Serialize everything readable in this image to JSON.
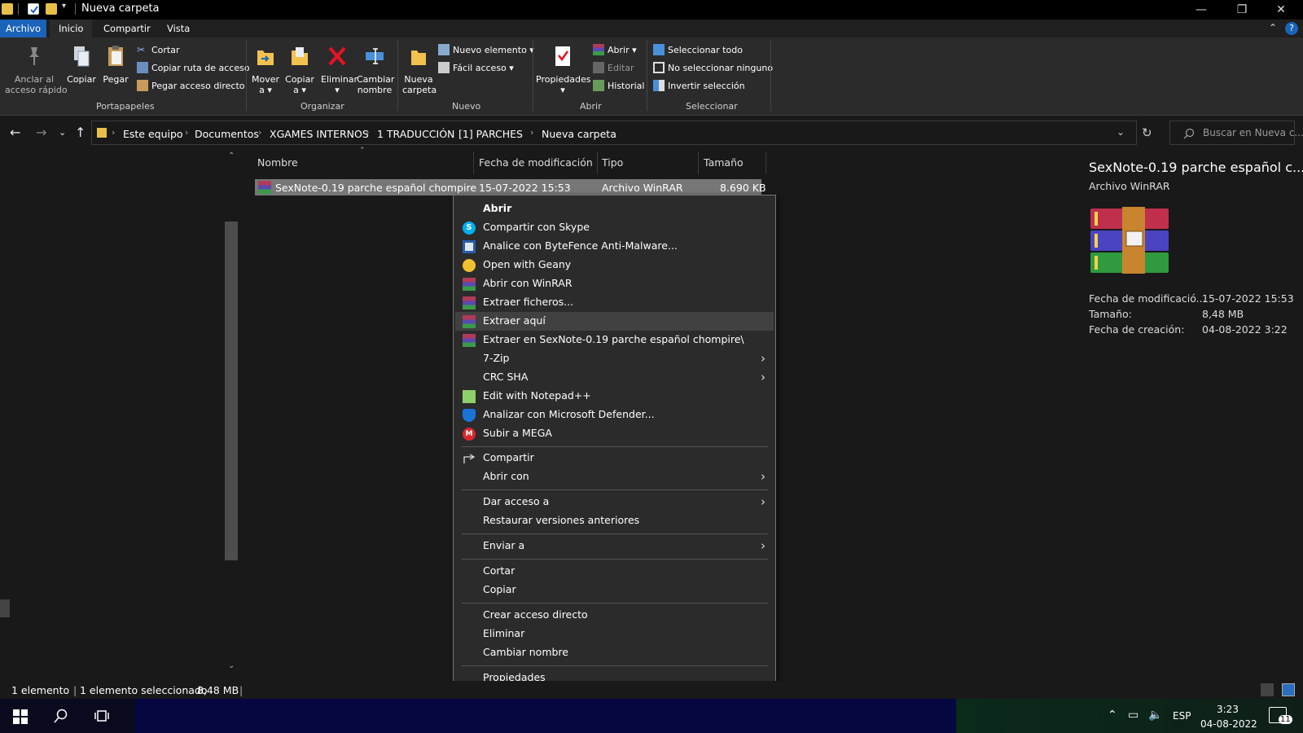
{
  "window": {
    "title": "Nueva carpeta",
    "controls": {
      "minimize": "—",
      "maximize": "❐",
      "close": "✕"
    }
  },
  "ribbon_tabs": [
    "Archivo",
    "Inicio",
    "Compartir",
    "Vista"
  ],
  "ribbon": {
    "portapapeles": {
      "anclar": "Anclar al\nacceso rápido",
      "copiar": "Copiar",
      "pegar": "Pegar",
      "cortar": "Cortar",
      "copiar_ruta": "Copiar ruta de acceso",
      "pegar_acceso": "Pegar acceso directo",
      "group": "Portapapeles"
    },
    "organizar": {
      "mover": "Mover\na ▾",
      "copiar": "Copiar\na ▾",
      "eliminar": "Eliminar\n▾",
      "cambiar": "Cambiar\nnombre",
      "group": "Organizar"
    },
    "nuevo": {
      "nueva_carpeta": "Nueva\ncarpeta",
      "nuevo_elemento": "Nuevo elemento ▾",
      "facil_acceso": "Fácil acceso ▾",
      "group": "Nuevo"
    },
    "abrir": {
      "propiedades": "Propiedades\n▾",
      "abrir": "Abrir ▾",
      "editar": "Editar",
      "historial": "Historial",
      "group": "Abrir"
    },
    "seleccionar": {
      "todo": "Seleccionar todo",
      "ninguno": "No seleccionar ninguno",
      "invertir": "Invertir selección",
      "group": "Seleccionar"
    }
  },
  "address": {
    "crumbs": [
      "Este equipo",
      "Documentos",
      "XGAMES INTERNOS",
      "1 TRADUCCIÓN",
      "[1] PARCHES",
      "Nueva carpeta"
    ],
    "search_placeholder": "Buscar en Nueva c..."
  },
  "columns": [
    "Nombre",
    "Fecha de modificación",
    "Tipo",
    "Tamaño"
  ],
  "file": {
    "name": "SexNote-0.19 parche español chompire",
    "date": "15-07-2022 15:53",
    "type": "Archivo WinRAR",
    "size": "8.690 KB"
  },
  "context_menu": [
    {
      "label": "Abrir",
      "icon": "none",
      "bold": true
    },
    {
      "label": "Compartir con Skype",
      "icon": "skype-icon"
    },
    {
      "label": "Analice con ByteFence Anti-Malware...",
      "icon": "bytefence-icon"
    },
    {
      "label": "Open with Geany",
      "icon": "geany-icon"
    },
    {
      "label": "Abrir con WinRAR",
      "icon": "winrar-icon"
    },
    {
      "label": "Extraer ficheros...",
      "icon": "winrar-icon"
    },
    {
      "label": "Extraer aquí",
      "icon": "winrar-icon",
      "highlight": true
    },
    {
      "label": "Extraer en SexNote-0.19 parche español chompire\\",
      "icon": "winrar-icon"
    },
    {
      "label": "7-Zip",
      "submenu": true
    },
    {
      "label": "CRC SHA",
      "submenu": true
    },
    {
      "label": "Edit with Notepad++",
      "icon": "notepadpp-icon"
    },
    {
      "label": "Analizar con Microsoft Defender...",
      "icon": "defender-icon"
    },
    {
      "label": "Subir a MEGA",
      "icon": "mega-icon"
    },
    {
      "label": "Compartir",
      "icon": "share-icon"
    },
    {
      "label": "Abrir con",
      "submenu": true
    },
    {
      "label": "Dar acceso a",
      "submenu": true
    },
    {
      "label": "Restaurar versiones anteriores"
    },
    {
      "label": "Enviar a",
      "submenu": true
    },
    {
      "label": "Cortar"
    },
    {
      "label": "Copiar"
    },
    {
      "label": "Crear acceso directo"
    },
    {
      "label": "Eliminar"
    },
    {
      "label": "Cambiar nombre"
    },
    {
      "label": "Propiedades"
    }
  ],
  "preview": {
    "title": "SexNote-0.19 parche español c...",
    "subtitle": "Archivo WinRAR",
    "props": [
      {
        "label": "Fecha de modificació...",
        "value": "15-07-2022 15:53"
      },
      {
        "label": "Tamaño:",
        "value": "8,48 MB"
      },
      {
        "label": "Fecha de creación:",
        "value": "04-08-2022 3:22"
      }
    ]
  },
  "status": {
    "count": "1 elemento",
    "selected": "1 elemento seleccionado",
    "size": "8,48 MB"
  },
  "taskbar": {
    "lang": "ESP",
    "time": "3:23",
    "date": "04-08-2022",
    "notif": "11"
  },
  "colors": {
    "accent": "#1a63b8",
    "menu_bg": "#2b2b2b",
    "window_bg": "#191919"
  }
}
